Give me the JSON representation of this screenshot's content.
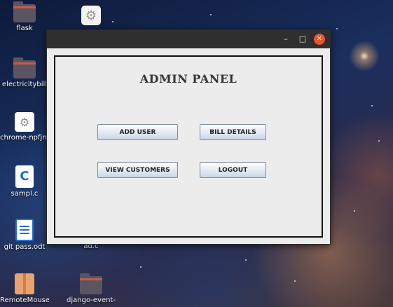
{
  "desktop": {
    "icons": [
      {
        "label": "flask"
      },
      {
        "label": "electricitybill"
      },
      {
        "label": "chrome-npfjnglnobng"
      },
      {
        "label": "sampl.c"
      },
      {
        "label": "git pass.odt"
      },
      {
        "label": "ad.c"
      },
      {
        "label": "RemoteMouse.t"
      },
      {
        "label": "django-event-"
      }
    ]
  },
  "window": {
    "controls": {
      "minimize": "–",
      "maximize": "□",
      "close": "✕"
    },
    "title": "ADMIN PANEL",
    "buttons": {
      "add_user": "ADD USER",
      "bill_details": "BILL DETAILS",
      "view_customers": "VIEW CUSTOMERS",
      "logout": "LOGOUT"
    }
  }
}
